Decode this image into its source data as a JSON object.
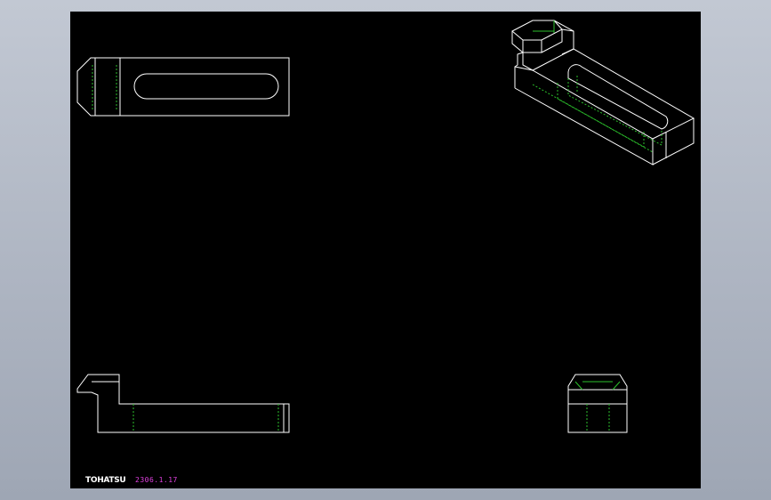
{
  "drawing": {
    "brand_text": "TOHATSU",
    "date_text": "2306.1.17"
  },
  "colors": {
    "background_outer": "#b3bac6",
    "viewport": "#000000",
    "visible_edges": "#ffffff",
    "hidden_edges": "#2bbf2b",
    "date_text": "#e040e0"
  }
}
